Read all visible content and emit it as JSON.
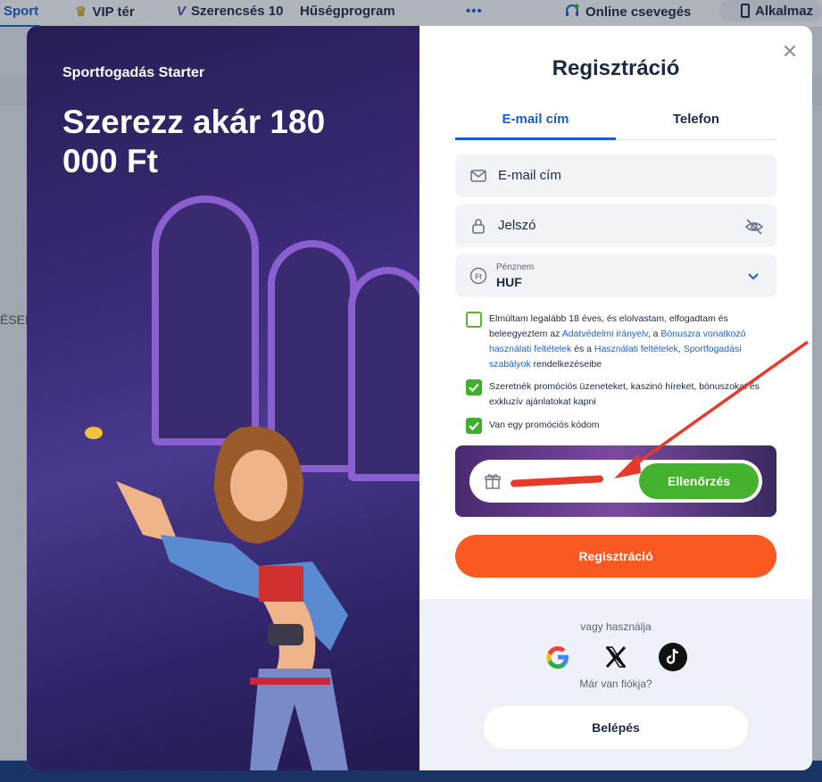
{
  "topnav": {
    "items": [
      "Sport",
      "VIP tér",
      "Szerencsés 10",
      "Hűségprogram",
      "•••",
      "Online csevegés",
      "Alkalmaz"
    ]
  },
  "background": {
    "side_text": "ÉSEK"
  },
  "promo": {
    "subtitle": "Sportfogadás Starter",
    "headline": "Szerezz akár 180 000 Ft"
  },
  "form": {
    "title": "Regisztráció",
    "tabs": [
      "E-mail cím",
      "Telefon"
    ],
    "active_tab": "E-mail cím",
    "email_placeholder": "E-mail cím",
    "password_placeholder": "Jelszó",
    "currency_caption": "Pénznem",
    "currency_value": "HUF",
    "consent": {
      "part1": "Elmúltam legalább 18 éves, és elolvastam, elfogadtam és beleegyeztem az ",
      "link1": "Adatvédelmi irányelv",
      "part2": ", a ",
      "link2": "Bónuszra vonatkozó használati feltételek",
      "part3": " és a ",
      "link3": "Használati feltételek",
      "part4": ", ",
      "link4": "Sportfogadási szabályok",
      "part5": " rendelkezéseibe",
      "checked": false
    },
    "promo_consent": {
      "text": "Szeretnék promóciós üzeneteket, kaszinó híreket, bónuszokat és exkluzív ajánlatokat kapni",
      "checked": true
    },
    "promo_code_toggle": {
      "text": "Van egy promóciós kódom",
      "checked": true
    },
    "check_button": "Ellenőrzés",
    "register_button": "Regisztráció",
    "or_use": "vagy használja",
    "social_icons": [
      "google-icon",
      "x-icon",
      "tiktok-icon"
    ],
    "have_account": "Már van fiókja?",
    "login_button": "Belépés"
  },
  "colors": {
    "accent": "#1a5fd0",
    "register": "#fa5a22",
    "check": "#45b22e",
    "annotation_arrow": "#e83a2a"
  }
}
